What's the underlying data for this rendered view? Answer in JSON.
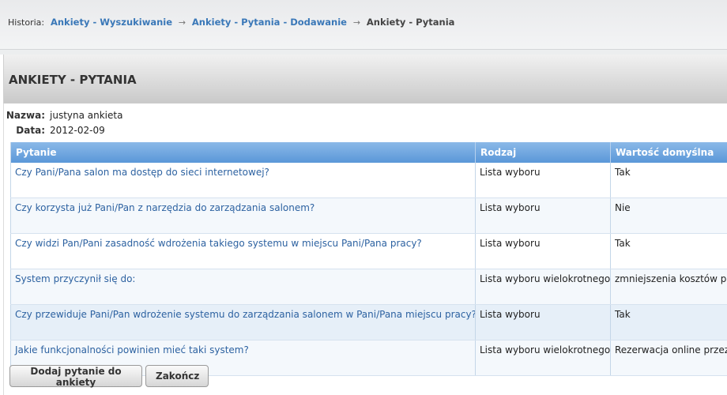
{
  "history": {
    "label": "Historia:",
    "crumbs": [
      {
        "text": "Ankiety - Wyszukiwanie"
      },
      {
        "text": "Ankiety - Pytania - Dodawanie"
      },
      {
        "text": "Ankiety - Pytania"
      }
    ],
    "arrow": "→"
  },
  "panel": {
    "title": "ANKIETY - PYTANIA",
    "name_label": "Nazwa:",
    "name_value": "justyna ankieta",
    "date_label": "Data:",
    "date_value": "2012-02-09"
  },
  "table": {
    "headers": [
      "Pytanie",
      "Rodzaj",
      "Wartość domyślna"
    ],
    "rows": [
      {
        "pytanie": "Czy Pani/Pana salon ma dostęp do sieci internetowej?",
        "rodzaj": "Lista wyboru",
        "wartosc": "Tak"
      },
      {
        "pytanie": "Czy korzysta już Pani/Pan z narzędzia do zarządzania salonem?",
        "rodzaj": "Lista wyboru",
        "wartosc": "Nie"
      },
      {
        "pytanie": "Czy widzi Pan/Pani zasadność wdrożenia takiego systemu w miejscu Pani/Pana pracy?",
        "rodzaj": "Lista wyboru",
        "wartosc": "Tak"
      },
      {
        "pytanie": "System przyczynił się do:",
        "rodzaj": "Lista wyboru wielokrotnego",
        "wartosc": "zmniejszenia kosztów prowadzenia"
      },
      {
        "pytanie": "Czy przewiduje Pani/Pan wdrożenie systemu do zarządzania salonem w Pani/Pana miejscu pracy?",
        "rodzaj": "Lista wyboru",
        "wartosc": "Tak"
      },
      {
        "pytanie": "Jakie funkcjonalności powinien mieć taki system?",
        "rodzaj": "Lista wyboru wielokrotnego",
        "wartosc": "Rezerwacja online przez klienta"
      }
    ]
  },
  "buttons": {
    "add_question": "Dodaj pytanie do ankiety",
    "finish": "Zakończ"
  },
  "colors": {
    "header_blue": "#5a97d8",
    "link_blue": "#3a78b8",
    "question_text": "#2d62a1"
  }
}
